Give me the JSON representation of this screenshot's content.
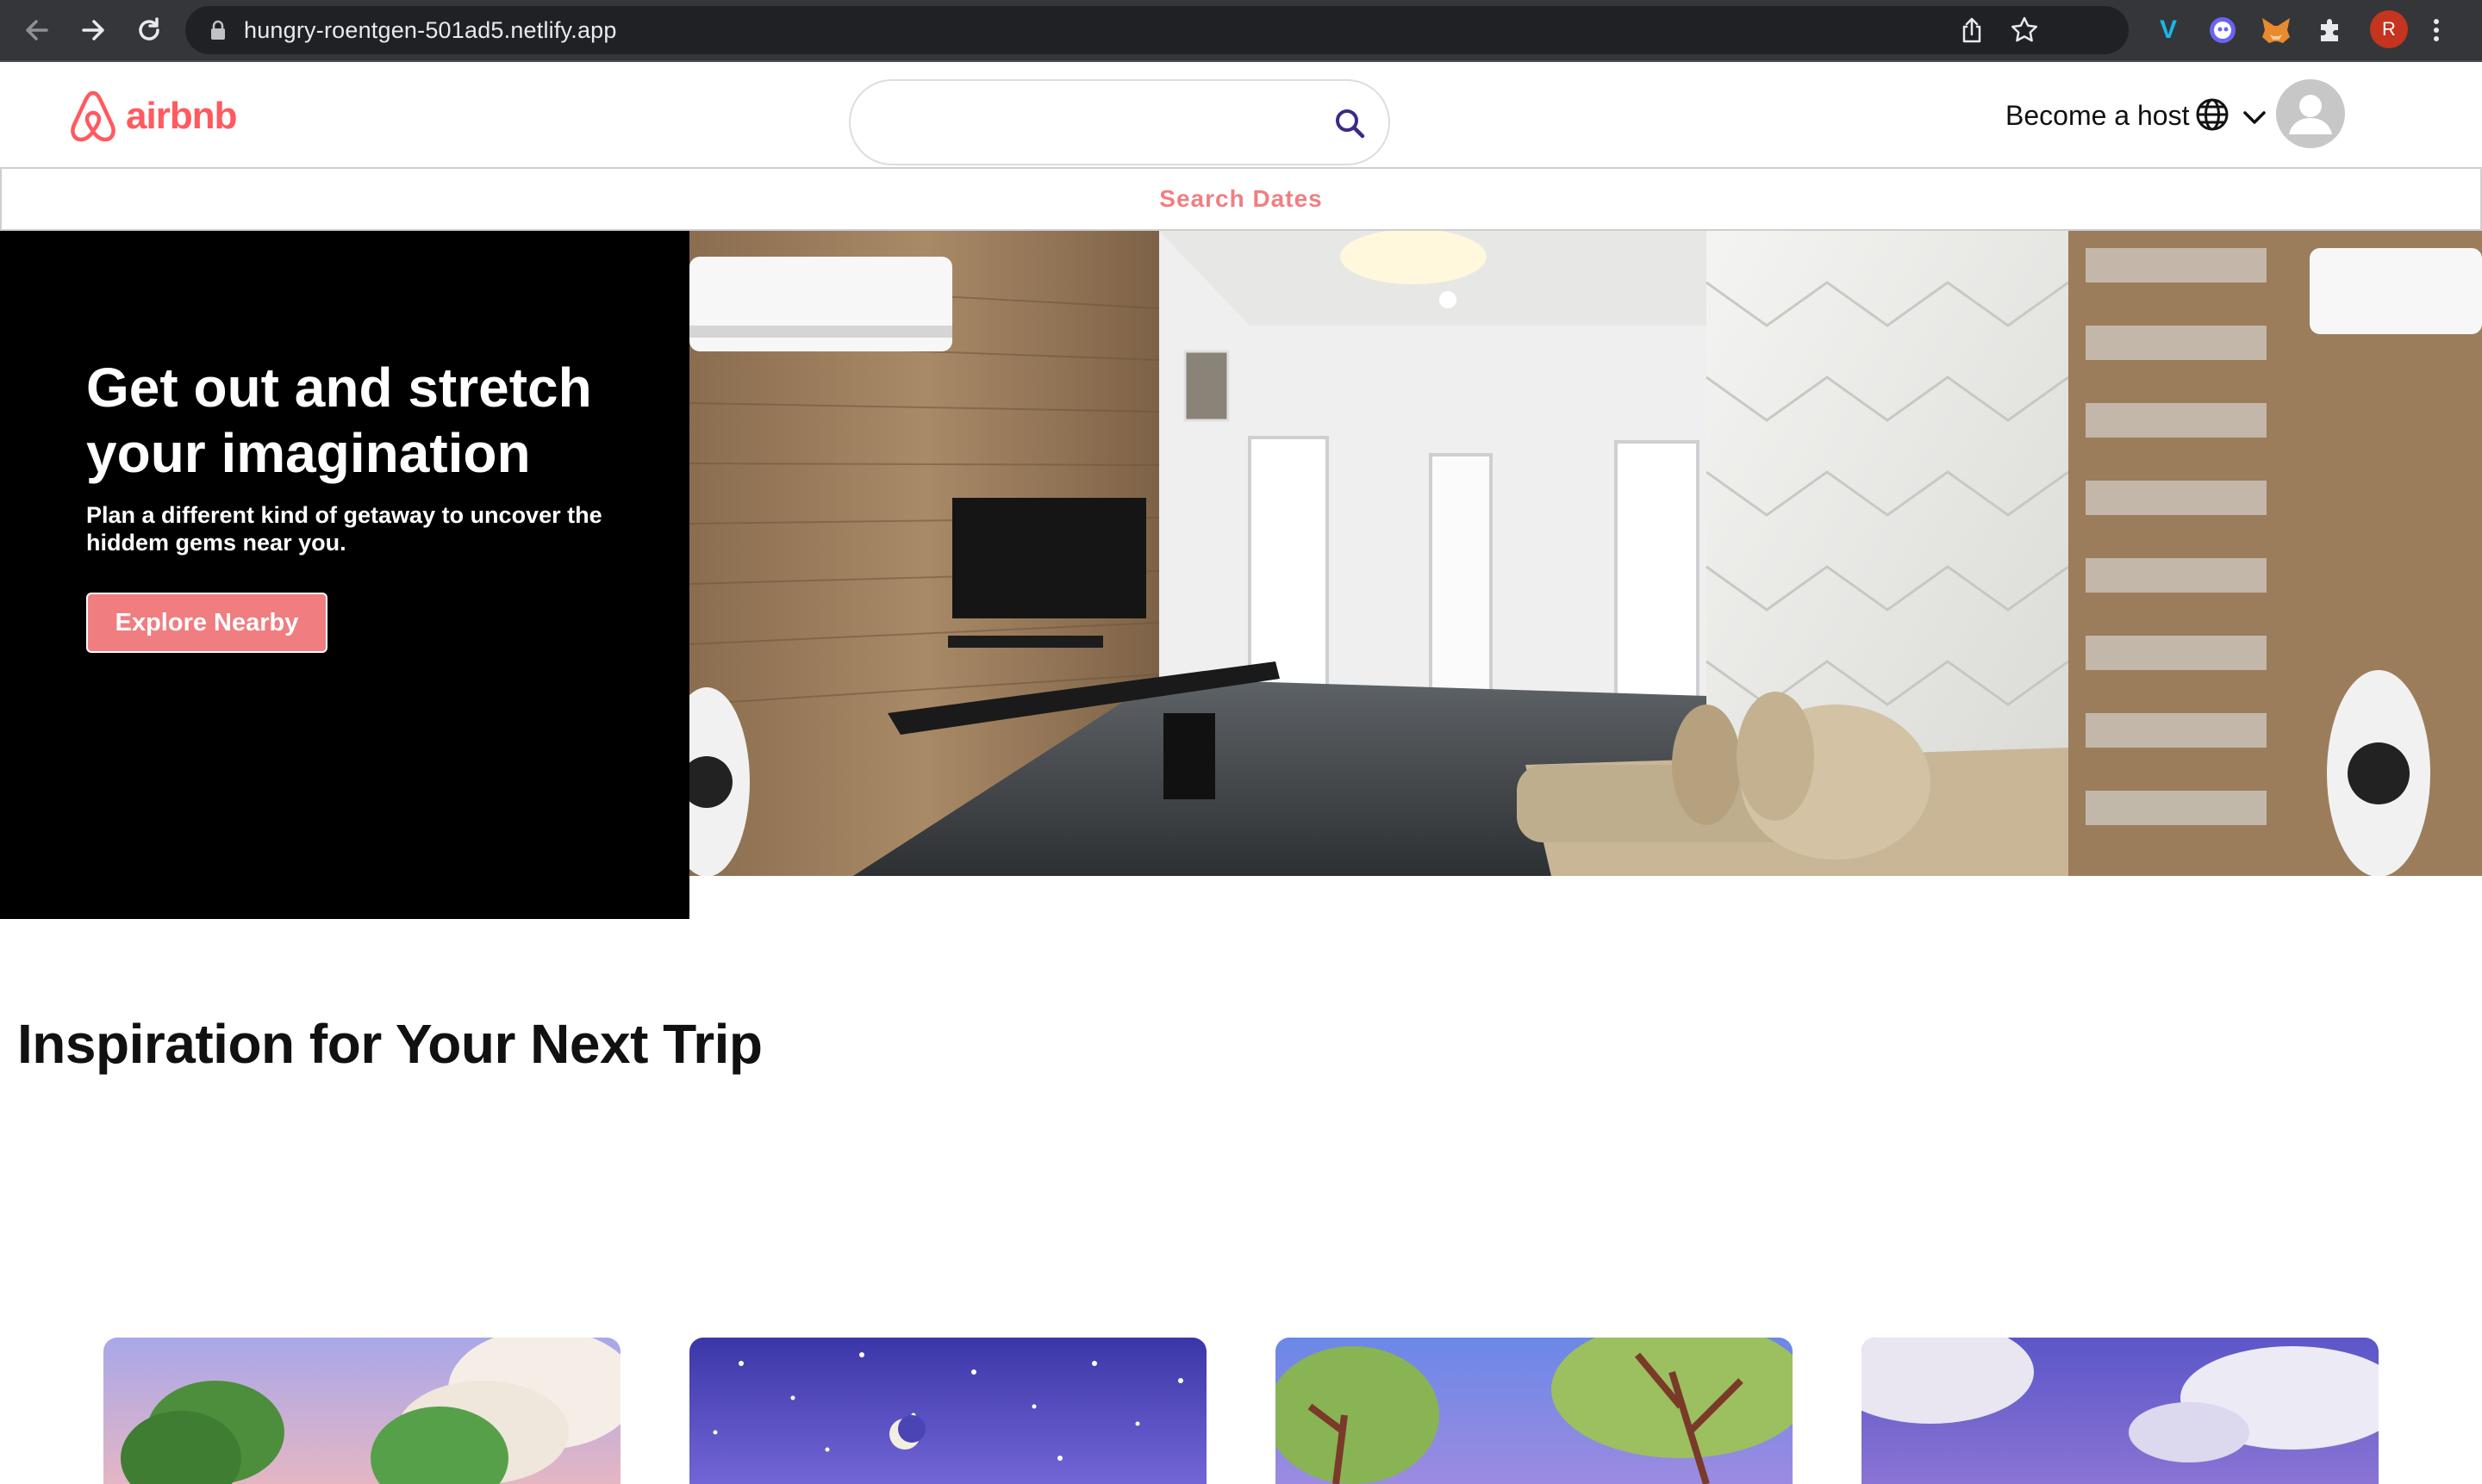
{
  "browser": {
    "url": "hungry-roentgen-501ad5.netlify.app",
    "profile_initial": "R",
    "icons": [
      "back-arrow-icon",
      "forward-arrow-icon",
      "reload-icon",
      "lock-icon",
      "share-icon",
      "star-icon",
      "vimeo-extension-icon",
      "ghost-extension-icon",
      "fox-extension-icon",
      "puzzle-extension-icon",
      "menu-dots-icon"
    ]
  },
  "header": {
    "logo_text": "airbnb",
    "search": {
      "placeholder": "",
      "value": ""
    },
    "become_host": "Become a host",
    "accent": "#ff5a5f"
  },
  "search_dates": {
    "label": "Search Dates",
    "color": "#ef7f82"
  },
  "hero": {
    "title": "Get out and stretch your imagination",
    "subtitle": "Plan a different kind of getaway to uncover the hiddem gems near you.",
    "cta": "Explore Nearby",
    "cta_color": "#f07d80"
  },
  "inspiration": {
    "title": "Inspiration for Your Next Trip",
    "cards": [
      {
        "theme": "forest-day"
      },
      {
        "theme": "night-sky"
      },
      {
        "theme": "trees-sky"
      },
      {
        "theme": "purple-clouds"
      }
    ]
  }
}
